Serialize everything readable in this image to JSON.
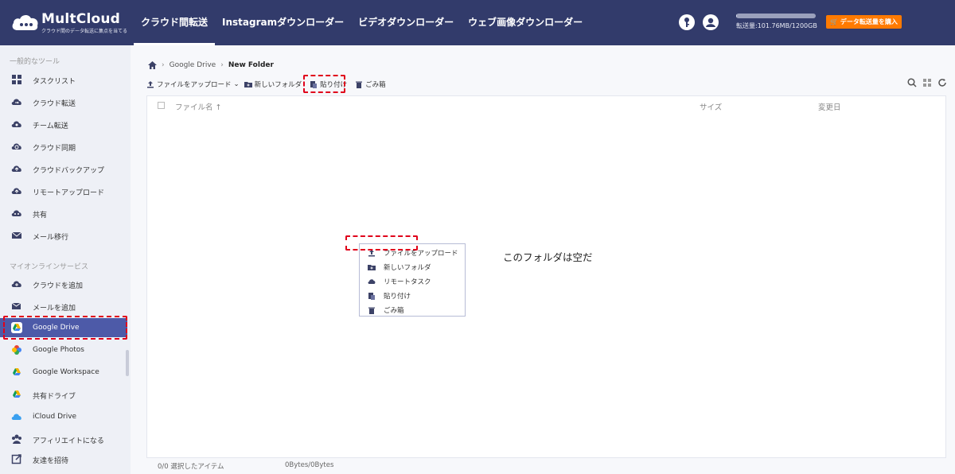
{
  "app": {
    "name": "MultCloud",
    "tagline": "クラウド間のデータ転送に集点を当てる"
  },
  "nav": {
    "items": [
      "クラウド間転送",
      "Instagramダウンローダー",
      "ビデオダウンローダー",
      "ウェブ画像ダウンローダー"
    ]
  },
  "header": {
    "usage_text": "転送量:101.76MB/1200GB",
    "usage_fraction": 0.0001,
    "buy_label": "データ転送量を購入"
  },
  "sidebar": {
    "section_tools": "一般的なツール",
    "tools": [
      {
        "label": "タスクリスト",
        "icon": "task-list-icon"
      },
      {
        "label": "クラウド転送",
        "icon": "cloud-transfer-icon"
      },
      {
        "label": "チーム転送",
        "icon": "team-transfer-icon"
      },
      {
        "label": "クラウド同期",
        "icon": "cloud-sync-icon"
      },
      {
        "label": "クラウドバックアップ",
        "icon": "cloud-backup-icon"
      },
      {
        "label": "リモートアップロード",
        "icon": "remote-upload-icon"
      },
      {
        "label": "共有",
        "icon": "share-icon"
      },
      {
        "label": "メール移行",
        "icon": "email-migration-icon"
      }
    ],
    "section_services": "マイオンラインサービス",
    "services": [
      {
        "label": "クラウドを追加",
        "icon": "add-cloud-icon"
      },
      {
        "label": "メールを追加",
        "icon": "add-email-icon"
      },
      {
        "label": "Google Drive",
        "icon": "google-drive-icon"
      },
      {
        "label": "Google Photos",
        "icon": "google-photos-icon"
      },
      {
        "label": "Google Workspace",
        "icon": "google-workspace-icon"
      },
      {
        "label": "共有ドライブ",
        "icon": "shared-drive-icon"
      },
      {
        "label": "iCloud Drive",
        "icon": "icloud-drive-icon"
      },
      {
        "label": "アフィリエイトになる",
        "icon": "affiliate-icon"
      },
      {
        "label": "友達を招待",
        "icon": "invite-friend-icon"
      }
    ],
    "active": "Google Drive"
  },
  "breadcrumb": {
    "root": "Google Drive",
    "current": "New Folder"
  },
  "toolbar": {
    "upload": "ファイルをアップロード",
    "new_folder": "新しいフォルダ",
    "paste": "貼り付け",
    "trash": "ごみ箱"
  },
  "table": {
    "col_name": "ファイル名",
    "col_size": "サイズ",
    "col_date": "変更日",
    "empty": "このフォルダは空だ"
  },
  "context_menu": {
    "items": [
      "ファイルをアップロード",
      "新しいフォルダ",
      "リモートタスク",
      "貼り付け",
      "ごみ箱"
    ]
  },
  "footer": {
    "selected": "0/0 選択したアイテム",
    "bytes": "0Bytes/0Bytes"
  },
  "colors": {
    "topbar": "#323b6b",
    "accent": "#4d5aa8",
    "buy_button": "#ff7a00",
    "highlight": "#e0001b"
  }
}
